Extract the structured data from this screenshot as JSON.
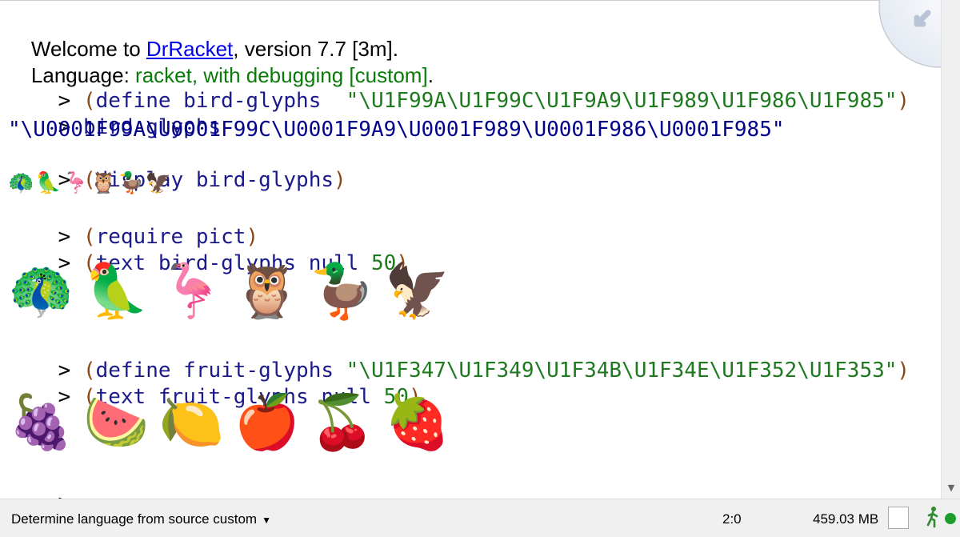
{
  "repl": {
    "welcome": {
      "prefix": "Welcome to ",
      "link": "DrRacket",
      "suffix": ", version 7.7 [3m]."
    },
    "language": {
      "prefix": "Language: ",
      "value": "racket, with debugging [custom]",
      "suffix": "."
    },
    "prompt": ">",
    "lines": [
      {
        "open": "(",
        "kw": "define bird-glyphs",
        "gap": "  ",
        "str": "\"\\U1F99A\\U1F99C\\U1F9A9\\U1F989\\U1F986\\U1F985\"",
        "close": ")"
      },
      {
        "sym": "bird-glyphs"
      },
      {
        "value": "\"\\U0001F99A\\U0001F99C\\U0001F9A9\\U0001F989\\U0001F986\\U0001F985\""
      },
      {
        "open": "(",
        "kw": "display bird-glyphs",
        "close": ")"
      },
      {
        "glyphs": "🦚🦜🦩🦉🦆🦅"
      },
      {
        "open": "(",
        "kw": "require pict",
        "close": ")"
      },
      {
        "open": "(",
        "kw": "text bird-glyphs null",
        "num": "50",
        "close": ")"
      },
      {
        "glyphs": "🦚🦜🦩🦉🦆🦅"
      },
      {
        "open": "(",
        "kw": "define fruit-glyphs",
        "str": "\"\\U1F347\\U1F349\\U1F34B\\U1F34E\\U1F352\\U1F353\"",
        "close": ")"
      },
      {
        "open": "(",
        "kw": "text fruit-glyphs null",
        "num": "50",
        "close": ")"
      },
      {
        "glyphs": "🍇🍉🍋🍎🍒🍓"
      }
    ]
  },
  "statusbar": {
    "language_menu": "Determine language from source custom",
    "language_menu_icon": "triangle-down-icon",
    "position": "2:0",
    "memory": "459.03 MB",
    "runner_icon": "running-man-icon",
    "status_color": "#1e9e2e"
  }
}
